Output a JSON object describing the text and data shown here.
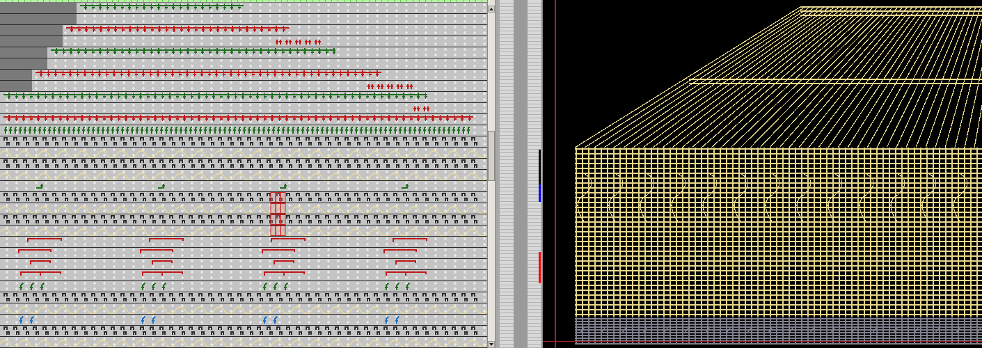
{
  "track_editor": {
    "rows": [
      {
        "kind": "wire",
        "color": "#1e6e1e",
        "selected": false
      },
      {
        "kind": "dots",
        "selected": false
      },
      {
        "kind": "wire",
        "color": "#c01818",
        "selected": false
      },
      {
        "kind": "ticks",
        "color": "#c01818",
        "selected": false
      },
      {
        "kind": "wire",
        "color": "#1e6e1e",
        "selected": false
      },
      {
        "kind": "dots",
        "selected": false
      },
      {
        "kind": "wire",
        "color": "#c01818",
        "selected": false
      },
      {
        "kind": "ticks",
        "color": "#c01818",
        "selected": false
      },
      {
        "kind": "wire",
        "color": "#1e6e1e",
        "selected": false
      },
      {
        "kind": "ticks",
        "color": "#c01818",
        "selected": false
      },
      {
        "kind": "wire",
        "color": "#c01818",
        "selected": false
      },
      {
        "kind": "pins",
        "color": "#1e6e1e",
        "selected": false
      },
      {
        "kind": "glyphs",
        "selected": false
      },
      {
        "kind": "wave",
        "selected": false
      },
      {
        "kind": "glyphs",
        "selected": false
      },
      {
        "kind": "wave",
        "selected": false
      },
      {
        "kind": "flags",
        "color": "#1e6e1e",
        "selected": false
      },
      {
        "kind": "glyphs",
        "selected": true
      },
      {
        "kind": "wave",
        "selected": true
      },
      {
        "kind": "glyphs",
        "selected": true
      },
      {
        "kind": "wave",
        "selected": true
      },
      {
        "kind": "brackets",
        "color": "#c01818",
        "selected": false
      },
      {
        "kind": "brackets",
        "color": "#c01818",
        "selected": false
      },
      {
        "kind": "brackets",
        "color": "#c01818",
        "selected": false
      },
      {
        "kind": "brackets",
        "color": "#c01818",
        "selected": false
      },
      {
        "kind": "flags",
        "color": "#1e6e1e",
        "selected": false
      },
      {
        "kind": "glyphs",
        "selected": false
      },
      {
        "kind": "wave",
        "selected": false
      },
      {
        "kind": "flags",
        "color": "#1a70c8",
        "selected": false
      },
      {
        "kind": "glyphs",
        "selected": false
      },
      {
        "kind": "wave",
        "selected": false
      }
    ]
  },
  "overview_strip": {
    "markers": [
      {
        "color": "#000000"
      },
      {
        "color": "#0000ff"
      },
      {
        "color": "#ff0000"
      }
    ]
  },
  "layout_canvas": {
    "layers": [
      {
        "kind": "metal",
        "color": "#e8d88c"
      },
      {
        "kind": "poly",
        "color": "#80808e"
      }
    ]
  }
}
